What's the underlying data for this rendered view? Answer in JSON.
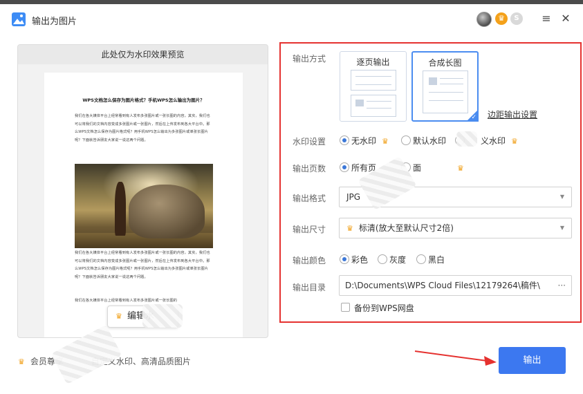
{
  "window": {
    "title": "输出为图片"
  },
  "titlebar": {
    "icon": "picture-export-icon",
    "avatar": "user-avatar",
    "vip_badge_icon": "crown-badge-icon",
    "coin_badge_icon": "coin-badge-icon",
    "menu_icon": "hamburger-icon",
    "close_icon": "close-icon"
  },
  "preview": {
    "header": "此处仅为水印效果预览",
    "doc_title": "WPS文档怎么保存为图片格式？手机WPS怎么输出为图片？",
    "paragraph_1": "我们在各大媒体平台上经常看到有人发布多张图片或一张长图的内容，其实，我们也可以将我们的文档内容变成多张图片或一张图片，然后在上传发布到各大平台中。那么WPS文档怎么保存为图片格式呢？用手机WPS怎么输出为多张图片或单张长图片呢？下面就告诉朋友大家说一说这两个问题。",
    "paragraph_2": "我们在各大媒体平台上经常看到有人发布多张图片或一张长图的内容，其实，我们也可以将我们的文档内容变成多张图片或一张图片，然后在上传发布到各大平台中。那么WPS文档怎么保存为图片格式呢？用手机WPS怎么输出为多张图片或单张长图片呢？下面就告诉朋友大家说一说这两个问题。",
    "paragraph_3": "我们在各大媒体平台上经常看到有人发布多张图片或一张长图的",
    "edit_watermark_button": "编辑水"
  },
  "vip_note": "会员尊享",
  "vip_note_tail": "自定义水印、高清品质图片",
  "settings": {
    "output_mode": {
      "label": "输出方式",
      "options": [
        "逐页输出",
        "合成长图"
      ],
      "selected": "合成长图",
      "margin_link": "边距输出设置"
    },
    "watermark": {
      "label": "水印设置",
      "options": [
        "无水印",
        "默认水印",
        "义水印"
      ],
      "selected": "无水印"
    },
    "pages": {
      "label": "输出页数",
      "options": [
        "所有页",
        "面"
      ],
      "selected": "所有页"
    },
    "format": {
      "label": "输出格式",
      "value": "JPG"
    },
    "size": {
      "label": "输出尺寸",
      "value": "标清(放大至默认尺寸2倍)"
    },
    "color": {
      "label": "输出颜色",
      "options": [
        "彩色",
        "灰度",
        "黑白"
      ],
      "selected": "彩色"
    },
    "directory": {
      "label": "输出目录",
      "path": "D:\\Documents\\WPS Cloud Files\\12179264\\稿件\\",
      "more": "···",
      "backup_label": "备份到WPS网盘"
    }
  },
  "export_button": "输出",
  "colors": {
    "accent": "#3c78f0",
    "highlight_border": "#e5312f",
    "crown": "#f0a01a"
  }
}
